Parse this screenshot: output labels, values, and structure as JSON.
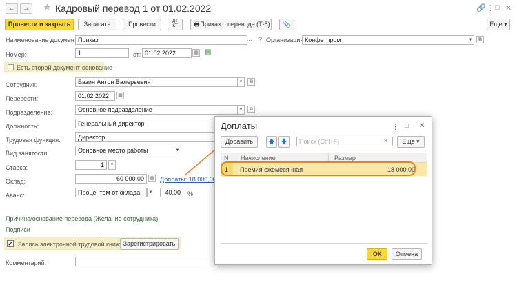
{
  "window": {
    "title": "Кадровый перевод 1 от 01.02.2022",
    "back": "←",
    "forward": "→",
    "star": "★",
    "icons": [
      "link-icon",
      "more-vert-icon",
      "maximize-icon",
      "close-icon"
    ]
  },
  "toolbar": {
    "post_close": "Провести и закрыть",
    "save": "Записать",
    "post": "Провести",
    "print_order": "Приказ о переводе (Т-5)",
    "more": "Еще ▾"
  },
  "form": {
    "doc_name_label": "Наименование документа:",
    "doc_name_value": "Приказ",
    "help": "?",
    "org_label": "Организация:",
    "org_value": "Конфетпром",
    "number_label": "Номер:",
    "number_value": "1",
    "from_label": "от:",
    "date_value": "01.02.2022",
    "second_basis_label": "Есть второй документ-основание",
    "employee_label": "Сотрудник:",
    "employee_value": "Базин Антон Валерьевич",
    "transfer_label": "Перевести:",
    "transfer_date": "01.02.2022",
    "dept_label": "Подразделение:",
    "dept_value": "Основное подразделение",
    "position_label": "Должность:",
    "position_value": "Генеральный директор",
    "function_label": "Трудовая функция:",
    "function_value": "Директор",
    "employment_label": "Вид занятости:",
    "employment_value": "Основное место работы",
    "rate_label": "Ставка:",
    "rate_value": "1",
    "salary_label": "Оклад:",
    "salary_value": "60 000,00",
    "bonus_link": "Доплаты: 18 000,00",
    "advance_label": "Аванс:",
    "advance_type": "Процентом от оклада",
    "advance_pct": "40,00",
    "pct_sign": "%",
    "reason_link": "Причина/основание перевода (Желание сотрудника)",
    "signatures_link": "Подписи",
    "ework_label": "Запись электронной трудовой книжки:",
    "register_btn": "Зарегистрировать",
    "comment_label": "Комментарий:"
  },
  "modal": {
    "title": "Доплаты",
    "add_btn": "Добавить",
    "search_placeholder": "Поиск (Ctrl+F)",
    "clear": "×",
    "more": "Еще ▾",
    "col_n": "N",
    "col_accrual": "Начисление",
    "col_amount": "Размер",
    "rows": [
      {
        "n": "1",
        "accrual": "Премия ежемесячная",
        "amount": "18 000,00"
      }
    ],
    "ok": "ОК",
    "cancel": "Отмена"
  },
  "colors": {
    "accent_yellow": "#fbd739",
    "annotation_orange": "#e5822e",
    "link_green": "#2c6e2c"
  }
}
